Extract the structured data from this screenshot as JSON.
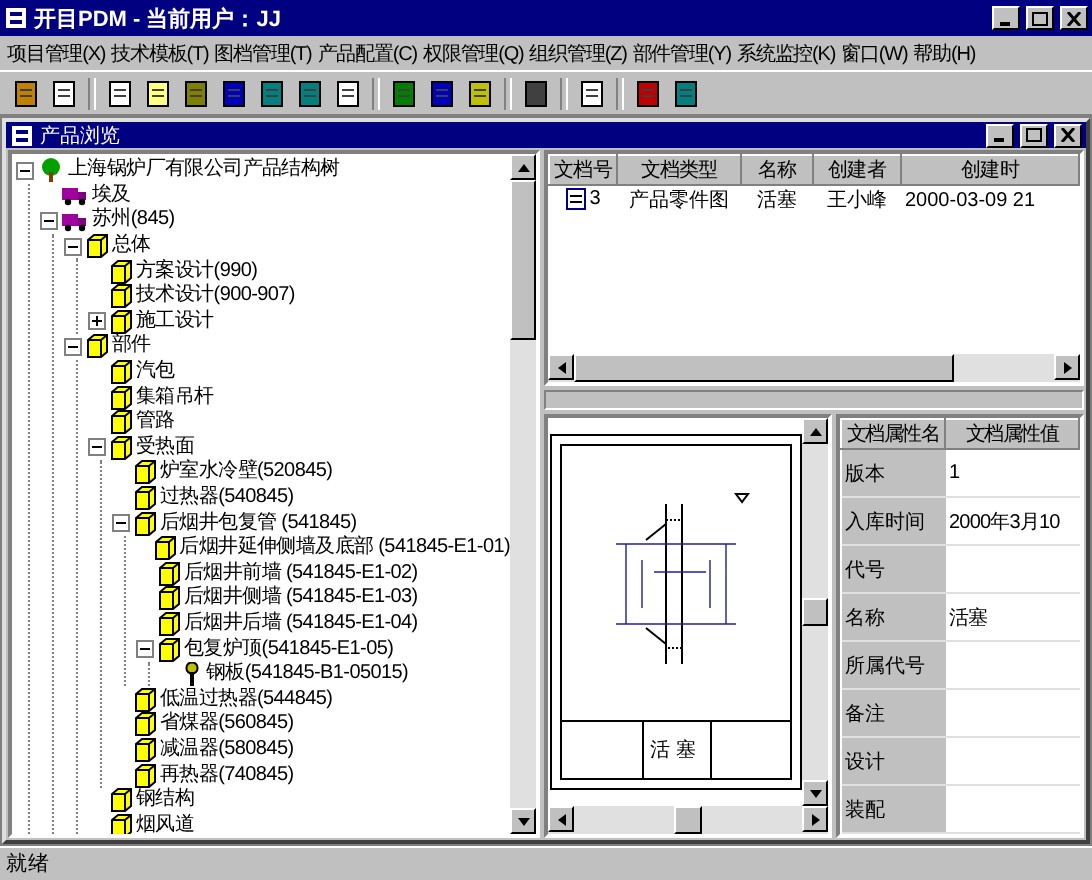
{
  "window": {
    "title": "开目PDM - 当前用户：JJ"
  },
  "menu": [
    "项目管理(X)",
    "技术模板(T)",
    "图档管理(T)",
    "产品配置(C)",
    "权限管理(Q)",
    "组织管理(Z)",
    "部件管理(Y)",
    "系统监控(K)",
    "窗口(W)",
    "帮助(H)"
  ],
  "child_window": {
    "title": "产品浏览"
  },
  "tree": [
    {
      "label": "上海锅炉厂有限公司产品结构树",
      "kind": "root",
      "expanded": true,
      "children": [
        {
          "label": "埃及",
          "kind": "site"
        },
        {
          "label": "苏州(845)",
          "kind": "site",
          "expanded": true,
          "children": [
            {
              "label": "总体",
              "kind": "group",
              "expanded": true,
              "children": [
                {
                  "label": "方案设计(990)",
                  "kind": "group"
                },
                {
                  "label": "技术设计(900-907)",
                  "kind": "group"
                },
                {
                  "label": "施工设计",
                  "kind": "group",
                  "expanded": false
                }
              ]
            },
            {
              "label": "部件",
              "kind": "group",
              "expanded": true,
              "children": [
                {
                  "label": "汽包",
                  "kind": "group"
                },
                {
                  "label": "集箱吊杆",
                  "kind": "group"
                },
                {
                  "label": "管路",
                  "kind": "group"
                },
                {
                  "label": "受热面",
                  "kind": "group",
                  "expanded": true,
                  "children": [
                    {
                      "label": "炉室水冷壁(520845)",
                      "kind": "group"
                    },
                    {
                      "label": "过热器(540845)",
                      "kind": "group"
                    },
                    {
                      "label": "后烟井包复管 (541845)",
                      "kind": "group",
                      "expanded": true,
                      "children": [
                        {
                          "label": "后烟井延伸侧墙及底部 (541845-E1-01)",
                          "kind": "group"
                        },
                        {
                          "label": "后烟井前墙 (541845-E1-02)",
                          "kind": "group"
                        },
                        {
                          "label": "后烟井侧墙 (541845-E1-03)",
                          "kind": "group"
                        },
                        {
                          "label": "后烟井后墙 (541845-E1-04)",
                          "kind": "group"
                        },
                        {
                          "label": "包复炉顶(541845-E1-05)",
                          "kind": "group",
                          "expanded": true,
                          "children": [
                            {
                              "label": "钢板(541845-B1-05015)",
                              "kind": "part"
                            }
                          ]
                        }
                      ]
                    },
                    {
                      "label": "低温过热器(544845)",
                      "kind": "group"
                    },
                    {
                      "label": "省煤器(560845)",
                      "kind": "group"
                    },
                    {
                      "label": "减温器(580845)",
                      "kind": "group"
                    },
                    {
                      "label": "再热器(740845)",
                      "kind": "group"
                    }
                  ]
                },
                {
                  "label": "钢结构",
                  "kind": "group"
                },
                {
                  "label": "烟风道",
                  "kind": "group"
                }
              ]
            }
          ]
        }
      ]
    }
  ],
  "documents": {
    "columns": [
      "文档号",
      "文档类型",
      "名称",
      "创建者",
      "创建时"
    ],
    "rows": [
      {
        "cells": [
          "3",
          "产品零件图",
          "活塞",
          "王小峰",
          "2000-03-09 21"
        ],
        "selected": false
      }
    ]
  },
  "preview": {
    "drawing_title": "活塞"
  },
  "properties": {
    "columns": [
      "文档属性名",
      "文档属性值"
    ],
    "rows": [
      {
        "name": "版本",
        "value": "1"
      },
      {
        "name": "入库时间",
        "value": "2000年3月10"
      },
      {
        "name": "代号",
        "value": ""
      },
      {
        "name": "名称",
        "value": "活塞"
      },
      {
        "name": "所属代号",
        "value": ""
      },
      {
        "name": "备注",
        "value": ""
      },
      {
        "name": "设计",
        "value": ""
      },
      {
        "name": "装配",
        "value": ""
      }
    ]
  },
  "status_bar": "就绪"
}
